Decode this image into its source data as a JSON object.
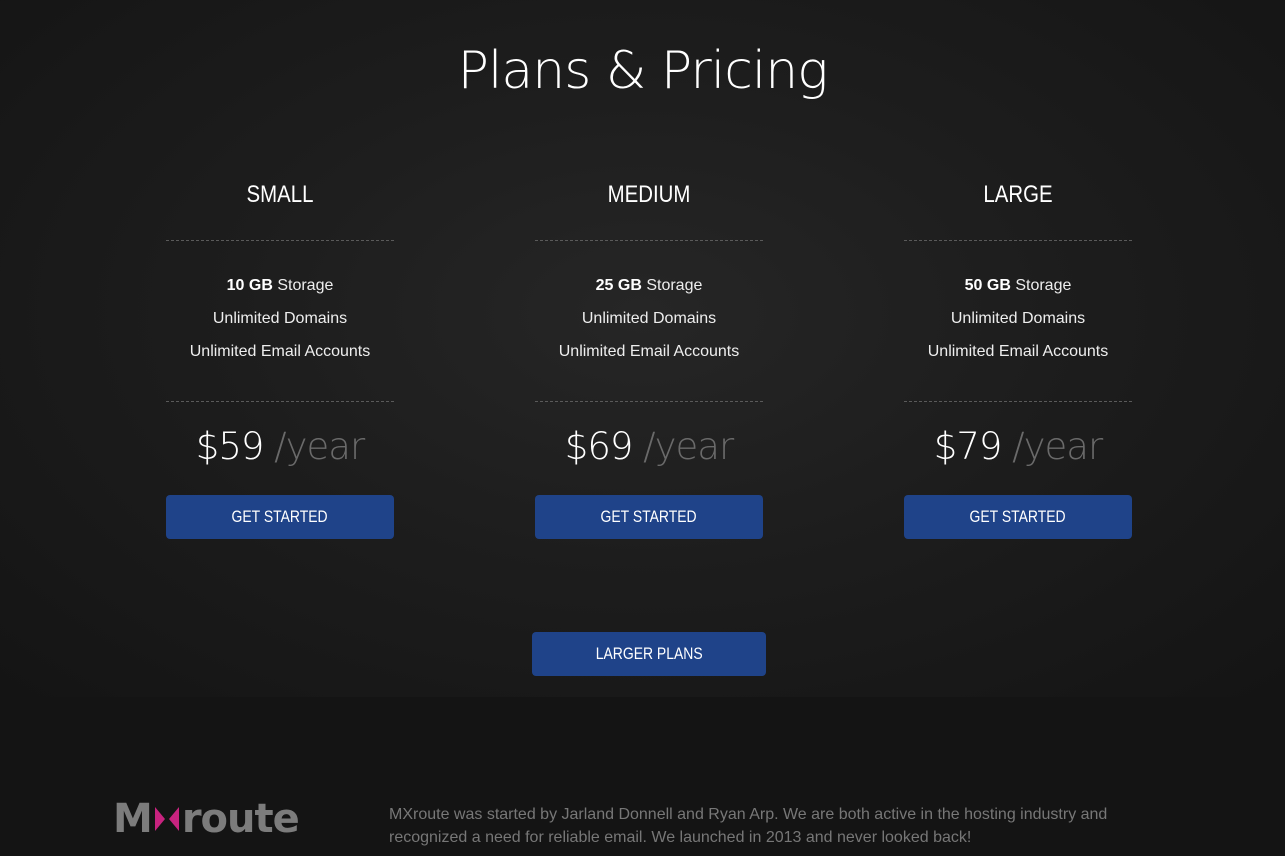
{
  "page": {
    "title": "Plans & Pricing"
  },
  "plans": [
    {
      "name": "SMALL",
      "storage_amount": "10 GB",
      "storage_label": " Storage",
      "domains": "Unlimited Domains",
      "emails": "Unlimited Email Accounts",
      "price": "$59",
      "period": " /year",
      "button_label": "GET STARTED"
    },
    {
      "name": "MEDIUM",
      "storage_amount": "25 GB",
      "storage_label": " Storage",
      "domains": "Unlimited Domains",
      "emails": "Unlimited Email Accounts",
      "price": "$69",
      "period": " /year",
      "button_label": "GET STARTED"
    },
    {
      "name": "LARGE",
      "storage_amount": "50 GB",
      "storage_label": " Storage",
      "domains": "Unlimited Domains",
      "emails": "Unlimited Email Accounts",
      "price": "$79",
      "period": " /year",
      "button_label": "GET STARTED"
    }
  ],
  "larger_plans": {
    "label": "LARGER PLANS"
  },
  "footer": {
    "logo_prefix": "M",
    "logo_suffix": "route",
    "logo_mark_icon": "x-chevrons-icon",
    "description": "MXroute was started by Jarland Donnell and Ryan Arp. We are both active in the hosting industry and recognized a need for reliable email. We launched in 2013 and never looked back!"
  },
  "colors": {
    "background": "#141414",
    "button": "#1f4389",
    "logo_accent": "#c8237f",
    "logo_text": "#7c7c7c",
    "muted_text": "#777777"
  }
}
